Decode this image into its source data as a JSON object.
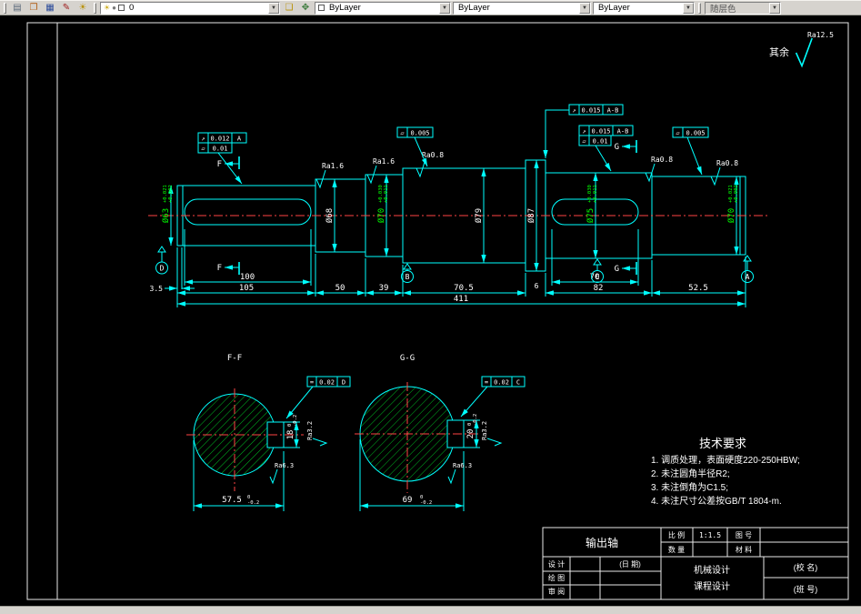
{
  "toolbar": {
    "layer_value": "0",
    "color_value": "ByLayer",
    "linetype_value": "ByLayer",
    "lineweight_value": "ByLayer",
    "plotstyle_value": "随层色"
  },
  "general": {
    "other_label": "其余",
    "roughness": "Ra12.5"
  },
  "dims": {
    "chamfer": "3.5",
    "keyway_left": "100",
    "seg1": "105",
    "seg2": "50",
    "seg3": "39",
    "seg4": "70.5",
    "collar": "6",
    "keyway_right": "70",
    "seg5": "82",
    "seg6": "52.5",
    "total": "411"
  },
  "dia": {
    "d63": {
      "v": "Ø63",
      "t": "+0.021",
      "b": "+0.002"
    },
    "d68": {
      "v": "Ø68"
    },
    "d70a": {
      "v": "Ø70",
      "t": "+0.030",
      "b": "+0.011"
    },
    "d79": {
      "v": "Ø79"
    },
    "d87": {
      "v": "Ø87"
    },
    "d75": {
      "v": "Ø75",
      "t": "+0.030",
      "b": "+0.011"
    },
    "d70b": {
      "v": "Ø70",
      "t": "+0.021",
      "b": "+0.002"
    }
  },
  "rough": {
    "r1": "Ra1.6",
    "r2": "Ra1.6",
    "r3": "Ra0.8",
    "r4": "Ra0.8",
    "r5": "Ra0.8",
    "key_f": "Ra3.2",
    "key_g": "Ra3.2",
    "sec_f": "Ra6.3",
    "sec_g": "Ra6.3"
  },
  "fcf": {
    "t1": {
      "sym": "↗",
      "val": "0.012",
      "ref": "A"
    },
    "t2": {
      "sym": "▱",
      "val": "0.01"
    },
    "t3": {
      "sym": "▱",
      "val": "0.005"
    },
    "t4": {
      "sym": "↗",
      "val": "0.015",
      "ref": "A-B"
    },
    "t5": {
      "sym": "↗",
      "val": "0.015",
      "ref": "A-B"
    },
    "t6": {
      "sym": "▱",
      "val": "0.01"
    },
    "t7": {
      "sym": "▱",
      "val": "0.005"
    },
    "f8": {
      "sym": "=",
      "val": "0.02",
      "ref": "D"
    },
    "f9": {
      "sym": "=",
      "val": "0.02",
      "ref": "C"
    }
  },
  "datum": {
    "left": "D",
    "mid": "B",
    "right_mid": "C",
    "right": "A"
  },
  "cut": {
    "f": "F",
    "g": "G"
  },
  "secff": {
    "title": "F-F",
    "w": "57.5",
    "wt": "0",
    "wb": "-0.2",
    "h": "18",
    "ht": "0",
    "hb": "-0.2"
  },
  "secgg": {
    "title": "G-G",
    "w": "69",
    "wt": "0",
    "wb": "-0.2",
    "h": "20",
    "ht": "0",
    "hb": "-0.2"
  },
  "tech": {
    "title": "技术要求",
    "l1": "1. 调质处理，表面硬度220-250HBW;",
    "l2": "2. 未注圆角半径R2;",
    "l3": "3. 未注倒角为C1.5;",
    "l4": "4. 未注尺寸公差按GB/T 1804-m."
  },
  "tb": {
    "part": "输出轴",
    "scale_label": "比 例",
    "scale_value": "1:1.5",
    "qty_label": "数 量",
    "no_label": "图 号",
    "mat_label": "材 料",
    "row1": "设 计",
    "row2": "绘 图",
    "row3": "审 阅",
    "date": "(日 期)",
    "course1": "机械设计",
    "course2": "课程设计",
    "school": "(校 名)",
    "class": "(班 号)"
  }
}
